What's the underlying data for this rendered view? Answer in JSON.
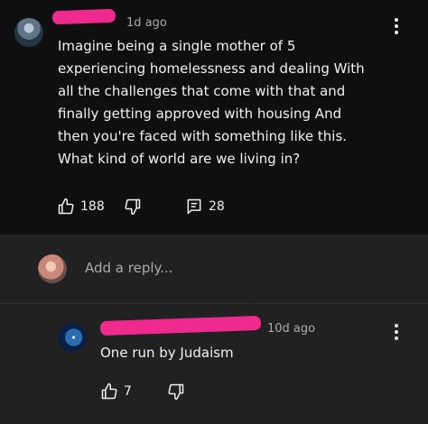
{
  "comment": {
    "timestamp": "1d ago",
    "text": "Imagine being a single mother of 5\nexperiencing homelessness and dealing With\nall the challenges that come with that and\nfinally getting approved with housing And\nthen you're faced with something like this.\nWhat kind of world are we living in?",
    "likes": "188",
    "reply_count": "28"
  },
  "reply_box": {
    "placeholder": "Add a reply..."
  },
  "reply": {
    "timestamp": "10d ago",
    "text": "One run by Judaism",
    "likes": "7"
  },
  "colors": {
    "redaction": "#ee2a8e",
    "background": "#0f0f0f",
    "reply_panel": "#212121"
  },
  "icons": [
    "thumb-up-icon",
    "thumb-down-icon",
    "replies-icon",
    "more-vert-icon"
  ]
}
